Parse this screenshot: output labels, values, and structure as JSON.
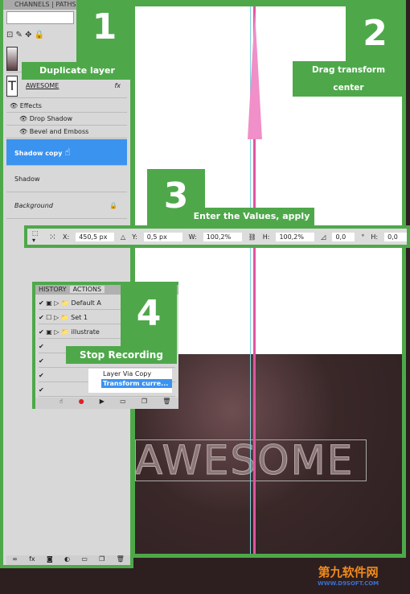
{
  "layers_panel": {
    "tabs": [
      "CHANNELS",
      "PATHS"
    ],
    "layers": [
      {
        "name": "AWESOME",
        "fx": "fx"
      },
      {
        "name": "Effects"
      },
      {
        "name": "Drop Shadow"
      },
      {
        "name": "Bevel and Emboss"
      },
      {
        "name": "Shadow copy",
        "selected": true
      },
      {
        "name": "Shadow"
      },
      {
        "name": "Background",
        "locked": true
      }
    ]
  },
  "steps": [
    {
      "number": "1",
      "label": "Duplicate layer"
    },
    {
      "number": "2",
      "label": "Drag transform center"
    },
    {
      "number": "3",
      "label": "Enter the Values, apply"
    },
    {
      "number": "4",
      "label": "Stop Recording"
    }
  ],
  "toolbar": {
    "x_label": "X:",
    "x_value": "450,5 px",
    "y_label": "Y:",
    "y_value": "0,5 px",
    "w_label": "W:",
    "w_value": "100,2%",
    "h_label": "H:",
    "h_value": "100,2%",
    "angle_value": "0,0",
    "angle_unit": "°",
    "h2_label": "H:",
    "h2_value": "0,0"
  },
  "actions_panel": {
    "tabs": [
      "HISTORY",
      "ACTIONS"
    ],
    "items": [
      "Default A",
      "Set 1",
      "illustrate",
      "Layer Via Copy",
      "Transform curre..."
    ]
  },
  "canvas": {
    "text": "AWESOME"
  },
  "watermark": {
    "cn": "第九软件网",
    "url": "WWW.D9SOFT.COM"
  },
  "colors": {
    "accent": "#4ea84a",
    "selection": "#3b93f0",
    "guide_pink": "#e0559f",
    "guide_cyan": "#7fd3df"
  }
}
